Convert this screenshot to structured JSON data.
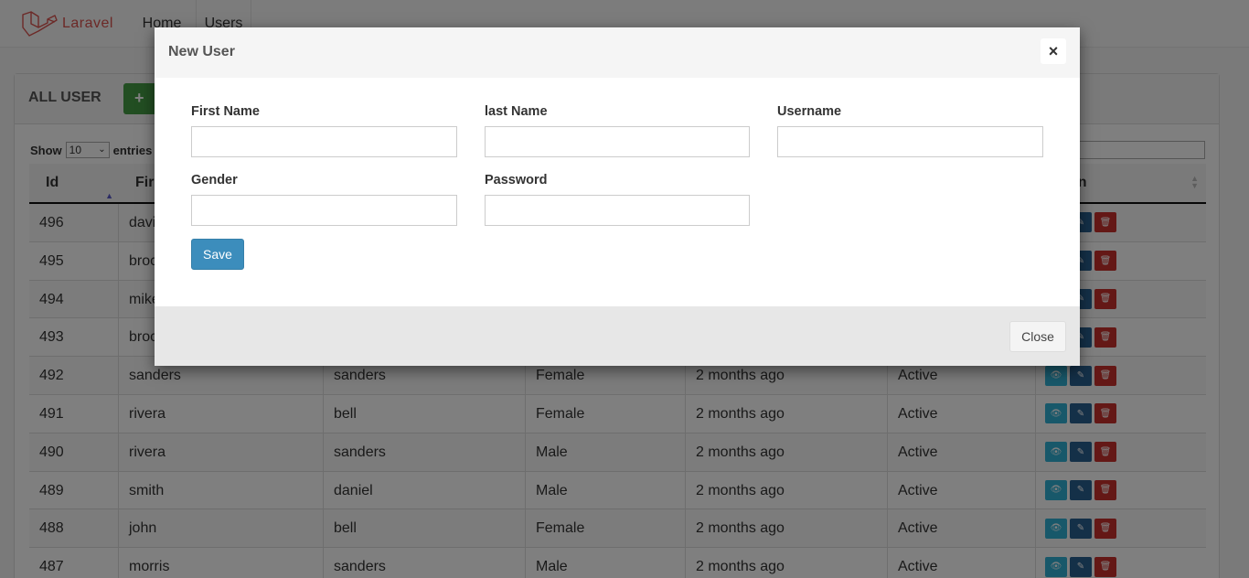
{
  "navbar": {
    "brand": "Laravel",
    "links": [
      "Home",
      "Users"
    ]
  },
  "panel": {
    "title": "ALL USER",
    "add_button_icon": "+",
    "show_label": "Show",
    "show_value": "10",
    "entries_label": "entries"
  },
  "table": {
    "headers": [
      "Id",
      "Fir",
      "",
      "",
      "",
      "",
      "on"
    ],
    "rows": [
      {
        "id": "496",
        "first": "davi",
        "last": "",
        "gender": "",
        "date": "",
        "status": ""
      },
      {
        "id": "495",
        "first": "broc",
        "last": "",
        "gender": "",
        "date": "",
        "status": ""
      },
      {
        "id": "494",
        "first": "mike",
        "last": "",
        "gender": "",
        "date": "",
        "status": ""
      },
      {
        "id": "493",
        "first": "broc",
        "last": "",
        "gender": "",
        "date": "",
        "status": ""
      },
      {
        "id": "492",
        "first": "sanders",
        "last": "sanders",
        "gender": "Female",
        "date": "2 months ago",
        "status": "Active"
      },
      {
        "id": "491",
        "first": "rivera",
        "last": "bell",
        "gender": "Female",
        "date": "2 months ago",
        "status": "Active"
      },
      {
        "id": "490",
        "first": "rivera",
        "last": "sanders",
        "gender": "Male",
        "date": "2 months ago",
        "status": "Active"
      },
      {
        "id": "489",
        "first": "smith",
        "last": "daniel",
        "gender": "Male",
        "date": "2 months ago",
        "status": "Active"
      },
      {
        "id": "488",
        "first": "john",
        "last": "bell",
        "gender": "Female",
        "date": "2 months ago",
        "status": "Active"
      },
      {
        "id": "487",
        "first": "morris",
        "last": "sanders",
        "gender": "Male",
        "date": "2 months ago",
        "status": "Active"
      }
    ]
  },
  "modal": {
    "title": "New User",
    "close_icon": "×",
    "fields": {
      "first_name": {
        "label": "First Name",
        "value": ""
      },
      "last_name": {
        "label": "last Name",
        "value": ""
      },
      "username": {
        "label": "Username",
        "value": ""
      },
      "gender": {
        "label": "Gender",
        "value": ""
      },
      "password": {
        "label": "Password",
        "value": ""
      }
    },
    "save_label": "Save",
    "close_label": "Close"
  },
  "colors": {
    "primary": "#3c8dbc",
    "success": "#449d44",
    "danger": "#c9302c",
    "info": "#31b0d5",
    "brand": "#d9534f"
  }
}
